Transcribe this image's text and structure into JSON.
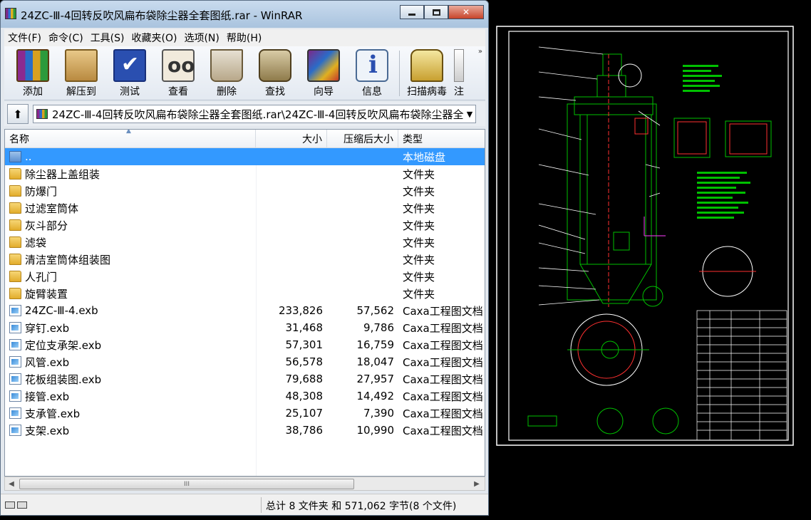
{
  "window": {
    "title": "24ZC-Ⅲ-4回转反吹风扁布袋除尘器全套图纸.rar - WinRAR"
  },
  "menu": [
    "文件(F)",
    "命令(C)",
    "工具(S)",
    "收藏夹(O)",
    "选项(N)",
    "帮助(H)"
  ],
  "toolbar": {
    "add": "添加",
    "extract": "解压到",
    "test": "测试",
    "view": "查看",
    "delete": "删除",
    "find": "查找",
    "wizard": "向导",
    "info": "信息",
    "virus_scan": "扫描病毒",
    "comment_partial": "注"
  },
  "address": {
    "path": "24ZC-Ⅲ-4回转反吹风扁布袋除尘器全套图纸.rar\\24ZC-Ⅲ-4回转反吹风扁布袋除尘器全"
  },
  "columns": {
    "name": "名称",
    "size": "大小",
    "packed": "压缩后大小",
    "type": "类型"
  },
  "files": [
    {
      "name": "..",
      "size": "",
      "packed": "",
      "type": "本地磁盘",
      "icon": "up-folder-icon"
    },
    {
      "name": "除尘器上盖组装",
      "size": "",
      "packed": "",
      "type": "文件夹",
      "icon": "folder-icon"
    },
    {
      "name": "防爆门",
      "size": "",
      "packed": "",
      "type": "文件夹",
      "icon": "folder-icon"
    },
    {
      "name": "过滤室筒体",
      "size": "",
      "packed": "",
      "type": "文件夹",
      "icon": "folder-icon"
    },
    {
      "name": "灰斗部分",
      "size": "",
      "packed": "",
      "type": "文件夹",
      "icon": "folder-icon"
    },
    {
      "name": "滤袋",
      "size": "",
      "packed": "",
      "type": "文件夹",
      "icon": "folder-icon"
    },
    {
      "name": "清洁室筒体组装图",
      "size": "",
      "packed": "",
      "type": "文件夹",
      "icon": "folder-icon"
    },
    {
      "name": "人孔门",
      "size": "",
      "packed": "",
      "type": "文件夹",
      "icon": "folder-icon"
    },
    {
      "name": "旋臂装置",
      "size": "",
      "packed": "",
      "type": "文件夹",
      "icon": "folder-icon"
    },
    {
      "name": "24ZC-Ⅲ-4.exb",
      "size": "233,826",
      "packed": "57,562",
      "type": "Caxa工程图文档",
      "icon": "exb-file-icon"
    },
    {
      "name": "穿钉.exb",
      "size": "31,468",
      "packed": "9,786",
      "type": "Caxa工程图文档",
      "icon": "exb-file-icon"
    },
    {
      "name": "定位支承架.exb",
      "size": "57,301",
      "packed": "16,759",
      "type": "Caxa工程图文档",
      "icon": "exb-file-icon"
    },
    {
      "name": "风管.exb",
      "size": "56,578",
      "packed": "18,047",
      "type": "Caxa工程图文档",
      "icon": "exb-file-icon"
    },
    {
      "name": "花板组装图.exb",
      "size": "79,688",
      "packed": "27,957",
      "type": "Caxa工程图文档",
      "icon": "exb-file-icon"
    },
    {
      "name": "接管.exb",
      "size": "48,308",
      "packed": "14,492",
      "type": "Caxa工程图文档",
      "icon": "exb-file-icon"
    },
    {
      "name": "支承管.exb",
      "size": "25,107",
      "packed": "7,390",
      "type": "Caxa工程图文档",
      "icon": "exb-file-icon"
    },
    {
      "name": "支架.exb",
      "size": "38,786",
      "packed": "10,990",
      "type": "Caxa工程图文档",
      "icon": "exb-file-icon"
    }
  ],
  "selected_index": 0,
  "scrollbar": {
    "thumb_grip": "III"
  },
  "status": {
    "summary": "总计 8 文件夹 和 571,062 字节(8 个文件)"
  },
  "colors": {
    "selection": "#3399ff",
    "cad_background": "#000000",
    "cad_frame": "#ffffff",
    "cad_green": "#00c000",
    "cad_red": "#ff3030",
    "cad_magenta": "#cc33cc"
  }
}
